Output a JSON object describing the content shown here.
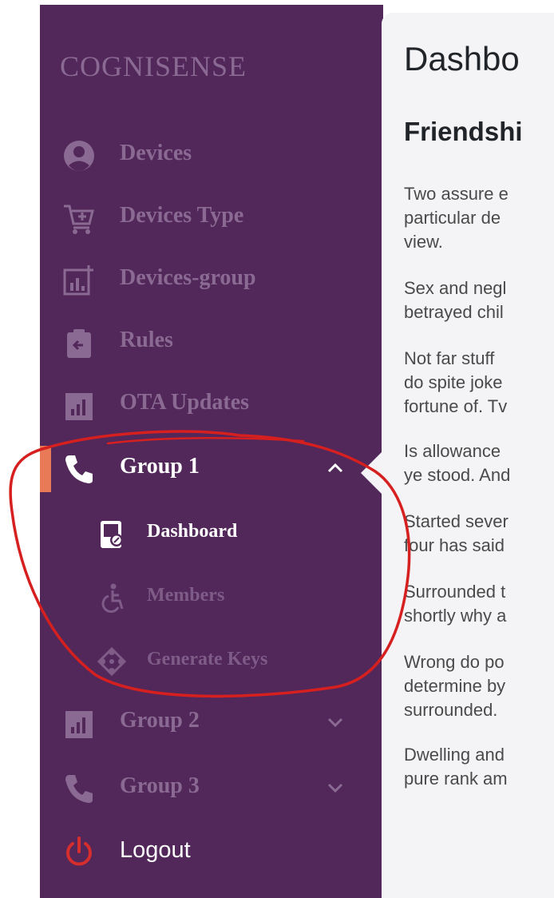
{
  "brand": "COGNISENSE",
  "colors": {
    "sidebar_bg": "#52285a",
    "muted_text": "#8a6a92",
    "active_text": "#ffffff",
    "accent_bar": "#e87a57",
    "logout_icon": "#d62d2d",
    "annotation": "#d61f1f",
    "content_bg": "#f4f4f6"
  },
  "sidebar": {
    "items": [
      {
        "label": "Devices",
        "icon": "user-circle-icon"
      },
      {
        "label": "Devices Type",
        "icon": "cart-plus-icon"
      },
      {
        "label": "Devices-group",
        "icon": "chart-add-icon"
      },
      {
        "label": "Rules",
        "icon": "clipboard-arrow-icon"
      },
      {
        "label": "OTA Updates",
        "icon": "bar-chart-icon"
      },
      {
        "label": "Group 1",
        "icon": "phone-icon",
        "expanded": true,
        "children": [
          {
            "label": "Dashboard",
            "icon": "dashboard-card-icon",
            "active": true
          },
          {
            "label": "Members",
            "icon": "wheelchair-icon"
          },
          {
            "label": "Generate Keys",
            "icon": "keys-network-icon"
          }
        ]
      },
      {
        "label": "Group 2",
        "icon": "bar-chart-icon",
        "expanded": false
      },
      {
        "label": "Group 3",
        "icon": "phone-icon",
        "expanded": false
      }
    ],
    "logout": {
      "label": "Logout",
      "icon": "power-icon"
    }
  },
  "main": {
    "title": "Dashbo",
    "section_title": "Friendshi",
    "paragraphs": [
      [
        "Two assure e",
        "particular de",
        "view."
      ],
      [
        "Sex and negl",
        "betrayed chil"
      ],
      [
        "Not far stuff",
        "do spite joke",
        "fortune of. Tv"
      ],
      [
        "Is allowance",
        "ye stood. And"
      ],
      [
        "Started sever",
        "four has said"
      ],
      [
        "Surrounded t",
        "shortly why a"
      ],
      [
        "Wrong do po",
        "determine by",
        "surrounded."
      ],
      [
        "Dwelling and",
        "pure rank am"
      ]
    ]
  }
}
